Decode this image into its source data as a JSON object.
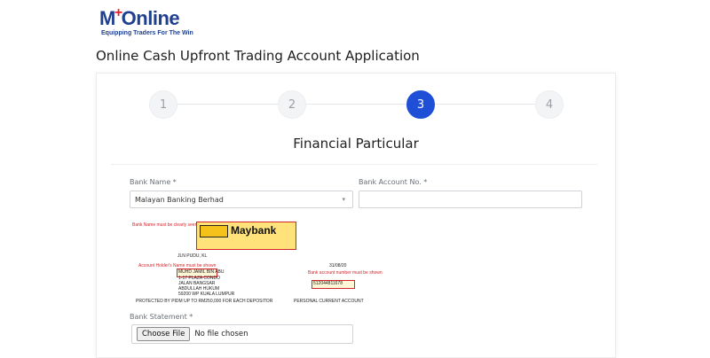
{
  "brand": {
    "logo_text": "M+Online",
    "tagline": "Equipping Traders For The Win"
  },
  "page": {
    "title": "Online Cash Upfront Trading Account Application"
  },
  "stepper": {
    "steps": [
      "1",
      "2",
      "3",
      "4"
    ],
    "active_step": 3
  },
  "section": {
    "title": "Financial Particular"
  },
  "form": {
    "bank_name_label": "Bank Name *",
    "bank_name_value": "Malayan Banking Berhad",
    "bank_account_label": "Bank Account No. *",
    "bank_account_value": "",
    "bank_statement_label": "Bank Statement *",
    "file_button": "Choose File",
    "file_status": "No file chosen"
  },
  "sample_statement": {
    "bank_logo_text": "Maybank",
    "note_bank_name": "Bank Name must be clearly seen",
    "note_holder": "Account Holder's Name must be shown",
    "note_account": "Bank account number must be shown",
    "address_city": "JLN PUDU, KL",
    "holder_lines": [
      "MUHD JAMIL BIN ABU",
      "1-17 PLAZA CONDO",
      "JALAN BANGSAR",
      "ABDULLAH HUKUM",
      "59200 WP KUALA LUMPUR"
    ],
    "date": "31/08/20",
    "account_number": "512044811678",
    "footer_left": "PROTECTED BY PIDM UP TO RM250,000 FOR EACH DEPOSITOR",
    "footer_right": "PERSONAL CURRENT ACCOUNT"
  },
  "colors": {
    "accent": "#1e4fd6",
    "brand_blue": "#1f3f8f",
    "brand_red": "#e0242a"
  }
}
